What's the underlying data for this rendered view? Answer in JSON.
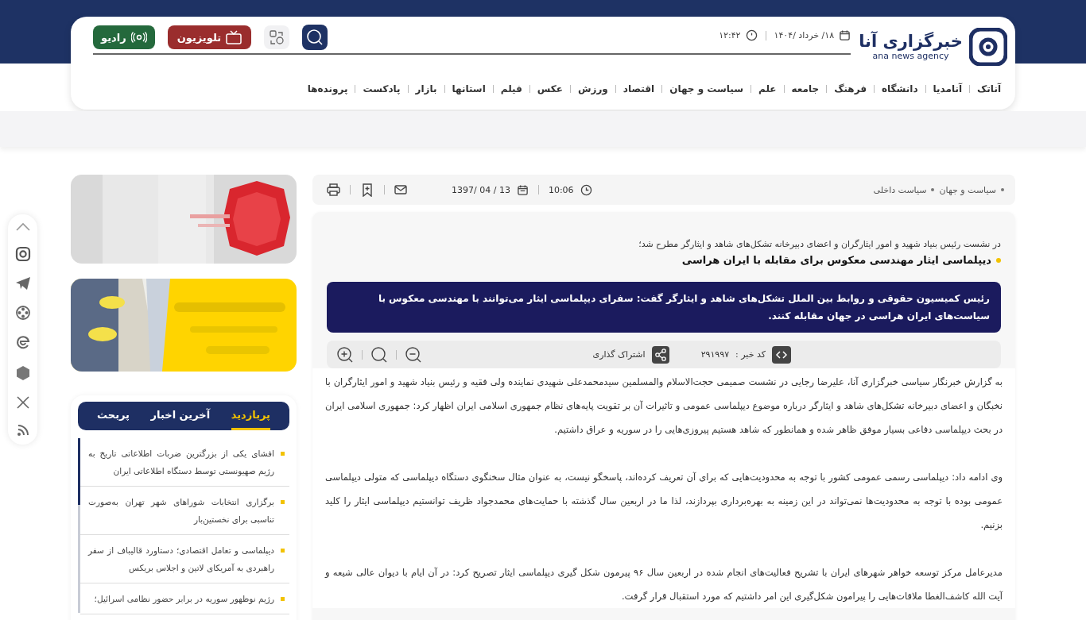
{
  "header": {
    "logo": {
      "name": "خبرگزاری آنا",
      "tagline": "ana news agency"
    },
    "date": "۱۸/ خرداد /۱۴۰۴",
    "time": "۱۲:۴۲",
    "buttons": [
      {
        "kind": "search"
      },
      {
        "kind": "translate"
      },
      {
        "kind": "tv",
        "label": "تلویزیون",
        "color": "#9a2d2d"
      },
      {
        "kind": "radio",
        "label": "رادیو",
        "color": "#24693c"
      }
    ],
    "nav": [
      "آناتک",
      "آنامدیا",
      "دانشگاه",
      "فرهنگ",
      "جامعه",
      "علم",
      "سیاست و جهان",
      "اقتصاد",
      "ورزش",
      "عکس",
      "فیلم",
      "استانها",
      "بازار",
      "پادکست",
      "پرونده‌ها"
    ]
  },
  "article": {
    "breadcrumb": [
      "سیاست و جهان",
      "سیاست داخلی"
    ],
    "time": "10:06",
    "date": "1397/ 04 / 13",
    "lead": "در نشست رئیس بنیاد شهید و امور ایثارگران و اعضای دبیرخانه تشکل‌های شاهد و ایثارگر مطرح شد؛",
    "title": "دیپلماسی ایثار مهندسی معکوس برای مقابله با ایران هراسی",
    "summary": "رئیس کمیسیون حقوقی و روابط بین الملل تشکل‌های شاهد و ایثارگر گفت: سفرای دیپلماسی ایثار می‌توانند با مهندسی معکوس با سیاست‌های ایران هراسی در جهان مقابله کنند.",
    "news_code_label": "کد خبر :",
    "news_code": "۲۹۱۹۹۷",
    "share": "اشتراک گذاری",
    "paragraphs": [
      "به گزارش خبرنگار سیاسی خبرگزاری آنا، علیرضا رجایی در نشست صمیمی حجت‌الاسلام والمسلمین سیدمحمدعلی شهیدی نماینده ولی فقیه و رئیس بنیاد شهید و امور ایثارگران با نخبگان و اعضای دبیرخانه تشکل‌های شاهد و ایثارگر درباره موضوع دیپلماسی عمومی و تاثیرات آن بر تقویت پایه‌های نظام جمهوری اسلامی ایران اظهار کرد: جمهوری اسلامی ایران در بحث دیپلماسی دفاعی بسیار موفق ظاهر شده و همانطور که شاهد هستیم پیروزی‌هایی را در سوریه و عراق داشتیم.",
      "وی ادامه داد: دیپلماسی رسمی عمومی کشور با توجه به محدودیت‌هایی که برای آن تعریف کرده‌اند، پاسخگو نیست، به عنوان مثال سخنگوی دستگاه دیپلماسی که متولی دیپلماسی عمومی بوده با توجه به محدودیت‌ها نمی‌تواند در این زمینه به بهره‌برداری بپردازند، لذا ما در اربعین سال گذشته با حمایت‌های محمدجواد ظریف توانستیم دیپلماسی ایثار را کلید بزنیم.",
      "مدیرعامل مرکز توسعه خواهر شهرهای ایران با تشریح فعالیت‌های انجام شده در اربعین سال ۹۶ پیرمون شکل گیری دیپلماسی ایثار تصریح کرد: در آن ایام با دیوان عالی شیعه و آیت الله کاشف‌الغطا ملاقات‌هایی را پیرامون شکل‌گیری این امر داشتیم که مورد استقبال قرار گرفت."
    ]
  },
  "sidebar": {
    "tabs": [
      {
        "label": "پربازدید",
        "selected": true
      },
      {
        "label": "آخرین اخبار",
        "selected": false
      },
      {
        "label": "پربحث",
        "selected": false
      }
    ],
    "items": [
      "افشای یکی از بزرگترین ضربات اطلاعاتی تاریخ به رژیم صهیونستی توسط دستگاه اطلاعاتی ایران",
      "برگزاری انتخابات شوراهای شهر تهران به‌صورت تناسبی برای نخستین‌بار",
      "دیپلماسی و تعامل اقتصادی؛ دستاورد قالیباف از سفر راهبردی به آمریکای لاتین و اجلاس بریکس",
      "رژیم نوظهور سوریه در برابر حضور نظامی اسرائیل؛"
    ]
  }
}
